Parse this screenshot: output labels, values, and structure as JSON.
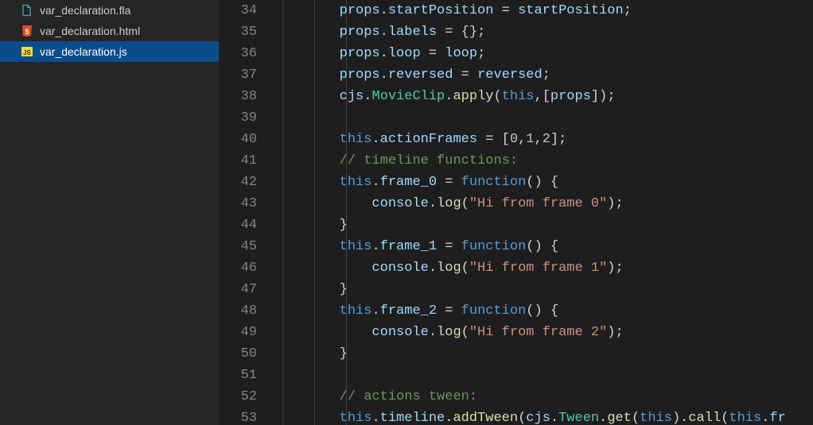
{
  "sidebar": {
    "files": [
      {
        "name": "var_declaration.fla",
        "iconType": "fla",
        "selected": false
      },
      {
        "name": "var_declaration.html",
        "iconType": "html",
        "selected": false
      },
      {
        "name": "var_declaration.js",
        "iconType": "js",
        "selected": true
      }
    ]
  },
  "editor": {
    "firstLineNumber": 34,
    "indentGuidesCh": [
      1,
      5,
      9
    ],
    "lines": [
      [
        [
          "        ",
          ""
        ],
        [
          "props",
          "tok-var"
        ],
        [
          ".",
          "tok-pun"
        ],
        [
          "startPosition",
          "tok-prop"
        ],
        [
          " = ",
          "tok-pun"
        ],
        [
          "startPosition",
          "tok-var"
        ],
        [
          ";",
          "tok-pun"
        ]
      ],
      [
        [
          "        ",
          ""
        ],
        [
          "props",
          "tok-var"
        ],
        [
          ".",
          "tok-pun"
        ],
        [
          "labels",
          "tok-prop"
        ],
        [
          " = {};",
          "tok-pun"
        ]
      ],
      [
        [
          "        ",
          ""
        ],
        [
          "props",
          "tok-var"
        ],
        [
          ".",
          "tok-pun"
        ],
        [
          "loop",
          "tok-prop"
        ],
        [
          " = ",
          "tok-pun"
        ],
        [
          "loop",
          "tok-var"
        ],
        [
          ";",
          "tok-pun"
        ]
      ],
      [
        [
          "        ",
          ""
        ],
        [
          "props",
          "tok-var"
        ],
        [
          ".",
          "tok-pun"
        ],
        [
          "reversed",
          "tok-prop"
        ],
        [
          " = ",
          "tok-pun"
        ],
        [
          "reversed",
          "tok-var"
        ],
        [
          ";",
          "tok-pun"
        ]
      ],
      [
        [
          "        ",
          ""
        ],
        [
          "cjs",
          "tok-var"
        ],
        [
          ".",
          "tok-pun"
        ],
        [
          "MovieClip",
          "tok-type"
        ],
        [
          ".",
          "tok-pun"
        ],
        [
          "apply",
          "tok-func"
        ],
        [
          "(",
          "tok-pun"
        ],
        [
          "this",
          "tok-kwblue"
        ],
        [
          ",[",
          "tok-pun"
        ],
        [
          "props",
          "tok-var"
        ],
        [
          "]);",
          "tok-pun"
        ]
      ],
      [],
      [
        [
          "        ",
          ""
        ],
        [
          "this",
          "tok-kwblue"
        ],
        [
          ".",
          "tok-pun"
        ],
        [
          "actionFrames",
          "tok-prop"
        ],
        [
          " = [",
          "tok-pun"
        ],
        [
          "0",
          "tok-num"
        ],
        [
          ",",
          "tok-pun"
        ],
        [
          "1",
          "tok-num"
        ],
        [
          ",",
          "tok-pun"
        ],
        [
          "2",
          "tok-num"
        ],
        [
          "];",
          "tok-pun"
        ]
      ],
      [
        [
          "        ",
          ""
        ],
        [
          "// timeline functions:",
          "tok-cmt"
        ]
      ],
      [
        [
          "        ",
          ""
        ],
        [
          "this",
          "tok-kwblue"
        ],
        [
          ".",
          "tok-pun"
        ],
        [
          "frame_0",
          "tok-prop"
        ],
        [
          " = ",
          "tok-pun"
        ],
        [
          "function",
          "tok-kwblue"
        ],
        [
          "() {",
          "tok-pun"
        ]
      ],
      [
        [
          "            ",
          ""
        ],
        [
          "console",
          "tok-var"
        ],
        [
          ".",
          "tok-pun"
        ],
        [
          "log",
          "tok-func"
        ],
        [
          "(",
          "tok-pun"
        ],
        [
          "\"Hi from frame 0\"",
          "tok-str"
        ],
        [
          ");",
          "tok-pun"
        ]
      ],
      [
        [
          "        ",
          ""
        ],
        [
          "}",
          "tok-pun"
        ]
      ],
      [
        [
          "        ",
          ""
        ],
        [
          "this",
          "tok-kwblue"
        ],
        [
          ".",
          "tok-pun"
        ],
        [
          "frame_1",
          "tok-prop"
        ],
        [
          " = ",
          "tok-pun"
        ],
        [
          "function",
          "tok-kwblue"
        ],
        [
          "() {",
          "tok-pun"
        ]
      ],
      [
        [
          "            ",
          ""
        ],
        [
          "console",
          "tok-var"
        ],
        [
          ".",
          "tok-pun"
        ],
        [
          "log",
          "tok-func"
        ],
        [
          "(",
          "tok-pun"
        ],
        [
          "\"Hi from frame 1\"",
          "tok-str"
        ],
        [
          ");",
          "tok-pun"
        ]
      ],
      [
        [
          "        ",
          ""
        ],
        [
          "}",
          "tok-pun"
        ]
      ],
      [
        [
          "        ",
          ""
        ],
        [
          "this",
          "tok-kwblue"
        ],
        [
          ".",
          "tok-pun"
        ],
        [
          "frame_2",
          "tok-prop"
        ],
        [
          " = ",
          "tok-pun"
        ],
        [
          "function",
          "tok-kwblue"
        ],
        [
          "() {",
          "tok-pun"
        ]
      ],
      [
        [
          "            ",
          ""
        ],
        [
          "console",
          "tok-var"
        ],
        [
          ".",
          "tok-pun"
        ],
        [
          "log",
          "tok-func"
        ],
        [
          "(",
          "tok-pun"
        ],
        [
          "\"Hi from frame 2\"",
          "tok-str"
        ],
        [
          ");",
          "tok-pun"
        ]
      ],
      [
        [
          "        ",
          ""
        ],
        [
          "}",
          "tok-pun"
        ]
      ],
      [],
      [
        [
          "        ",
          ""
        ],
        [
          "// actions tween:",
          "tok-cmt"
        ]
      ],
      [
        [
          "        ",
          ""
        ],
        [
          "this",
          "tok-kwblue"
        ],
        [
          ".",
          "tok-pun"
        ],
        [
          "timeline",
          "tok-prop"
        ],
        [
          ".",
          "tok-pun"
        ],
        [
          "addTween",
          "tok-func"
        ],
        [
          "(",
          "tok-pun"
        ],
        [
          "cjs",
          "tok-var"
        ],
        [
          ".",
          "tok-pun"
        ],
        [
          "Tween",
          "tok-type"
        ],
        [
          ".",
          "tok-pun"
        ],
        [
          "get",
          "tok-func"
        ],
        [
          "(",
          "tok-pun"
        ],
        [
          "this",
          "tok-kwblue"
        ],
        [
          ").",
          "tok-pun"
        ],
        [
          "call",
          "tok-func"
        ],
        [
          "(",
          "tok-pun"
        ],
        [
          "this",
          "tok-kwblue"
        ],
        [
          ".",
          "tok-pun"
        ],
        [
          "fr",
          "tok-prop"
        ]
      ]
    ]
  },
  "icons": {
    "fla": {
      "bg": "transparent",
      "fg": "#519aba",
      "shape": "page"
    },
    "html": {
      "bg": "#e44d26",
      "fg": "#ffffff",
      "shape": "shield",
      "text": "5"
    },
    "js": {
      "bg": "#f1dd3f",
      "fg": "#333333",
      "shape": "square",
      "text": "JS"
    }
  }
}
